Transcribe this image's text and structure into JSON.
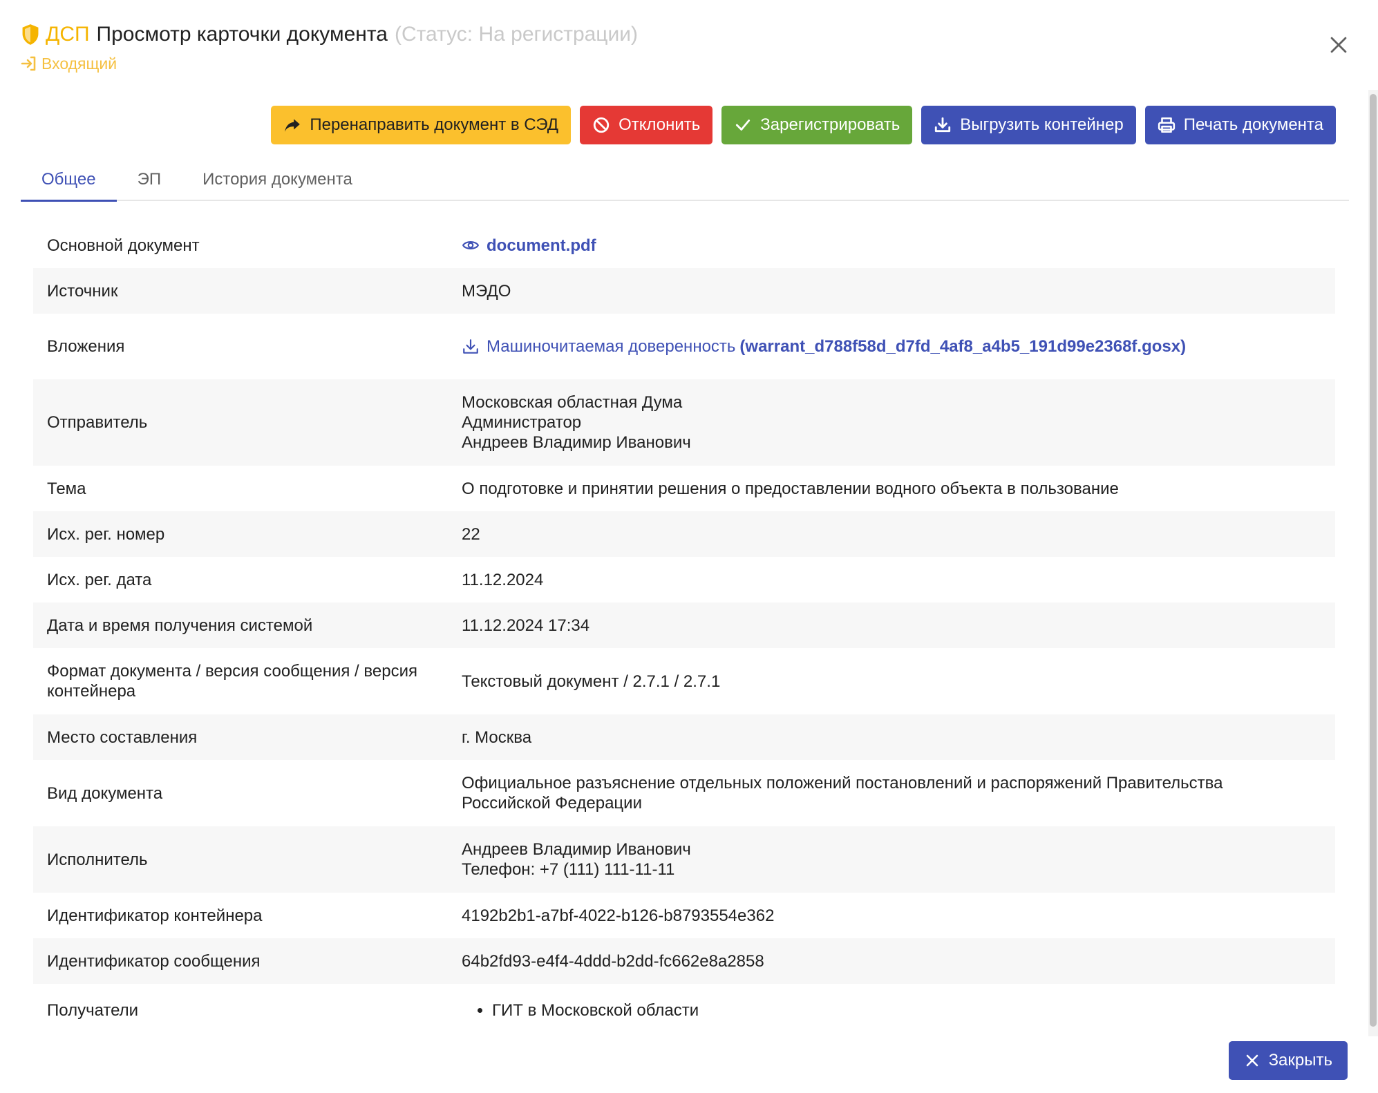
{
  "header": {
    "classification": "ДСП",
    "title": "Просмотр карточки документа",
    "status": "(Статус: На регистрации)",
    "direction": "Входящий"
  },
  "toolbar": {
    "redirect_label": "Перенаправить документ в СЭД",
    "reject_label": "Отклонить",
    "register_label": "Зарегистрировать",
    "export_label": "Выгрузить контейнер",
    "print_label": "Печать документа"
  },
  "tabs": [
    {
      "label": "Общее",
      "active": true
    },
    {
      "label": "ЭП",
      "active": false
    },
    {
      "label": "История документа",
      "active": false
    }
  ],
  "fields": {
    "main_document": {
      "label": "Основной документ",
      "value": "document.pdf"
    },
    "source": {
      "label": "Источник",
      "value": "МЭДО"
    },
    "attachments": {
      "label": "Вложения",
      "name": "Машиночитаемая доверенность",
      "file": "(warrant_d788f58d_d7fd_4af8_a4b5_191d99e2368f.gosx)"
    },
    "sender": {
      "label": "Отправитель",
      "lines": [
        "Московская областная Дума",
        "Администратор",
        "Андреев Владимир Иванович"
      ]
    },
    "subject": {
      "label": "Тема",
      "value": "О подготовке и принятии решения о предоставлении водного объекта в пользование"
    },
    "out_reg_number": {
      "label": "Исх. рег. номер",
      "value": "22"
    },
    "out_reg_date": {
      "label": "Исх. рег. дата",
      "value": "11.12.2024"
    },
    "received_at": {
      "label": "Дата и время получения системой",
      "value": "11.12.2024 17:34"
    },
    "format": {
      "label": "Формат документа / версия сообщения / версия контейнера",
      "value": "Текстовый документ / 2.7.1 / 2.7.1"
    },
    "place": {
      "label": "Место составления",
      "value": "г. Москва"
    },
    "doc_type": {
      "label": "Вид документа",
      "value": "Официальное разъяснение отдельных положений постановлений и распоряжений Правительства Российской Федерации"
    },
    "executor": {
      "label": "Исполнитель",
      "lines": [
        "Андреев Владимир Иванович",
        "Телефон: +7 (111) 111-11-11"
      ]
    },
    "container_id": {
      "label": "Идентификатор контейнера",
      "value": "4192b2b1-a7bf-4022-b126-b8793554e362"
    },
    "message_id": {
      "label": "Идентификатор сообщения",
      "value": "64b2fd93-e4f4-4ddd-b2dd-fc662e8a2858"
    },
    "recipients": {
      "label": "Получатели",
      "items": [
        "ГИТ в Московской области"
      ]
    }
  },
  "footer": {
    "close_label": "Закрыть"
  },
  "colors": {
    "primary": "#3f51b5",
    "warning": "#fbc02d",
    "danger": "#e53935",
    "success": "#67a73a",
    "dsp": "#f5b400"
  }
}
